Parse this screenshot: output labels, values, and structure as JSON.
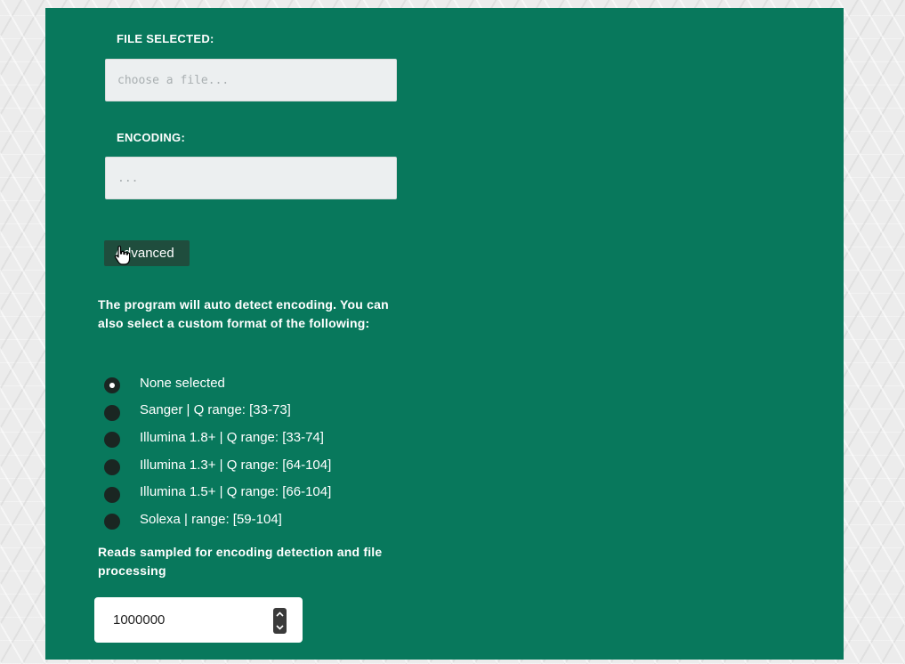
{
  "form": {
    "file_label": "FILE SELECTED:",
    "file_placeholder": "choose a file...",
    "encoding_label": "ENCODING:",
    "encoding_placeholder": "...",
    "advanced_label": "Advanced",
    "description": "The program will auto detect encoding. You can also select a custom format of the following:",
    "encoding_options": [
      {
        "label": "None selected",
        "selected": true
      },
      {
        "label": "Sanger | Q range: [33-73]",
        "selected": false
      },
      {
        "label": "Illumina 1.8+ | Q range: [33-74]",
        "selected": false
      },
      {
        "label": "Illumina 1.3+ | Q range: [64-104]",
        "selected": false
      },
      {
        "label": "Illumina 1.5+ | Q range: [66-104]",
        "selected": false
      },
      {
        "label": "Solexa | range: [59-104]",
        "selected": false
      }
    ],
    "reads_label": "Reads sampled for encoding detection and file processing",
    "reads_value": "1000000"
  },
  "colors": {
    "panel": "#08785c",
    "button": "#1f4d3d",
    "radio": "#1a2622"
  },
  "icons": {
    "cursor": "hand-pointer-icon",
    "stepper_up": "chevron-up-icon",
    "stepper_down": "chevron-down-icon"
  }
}
